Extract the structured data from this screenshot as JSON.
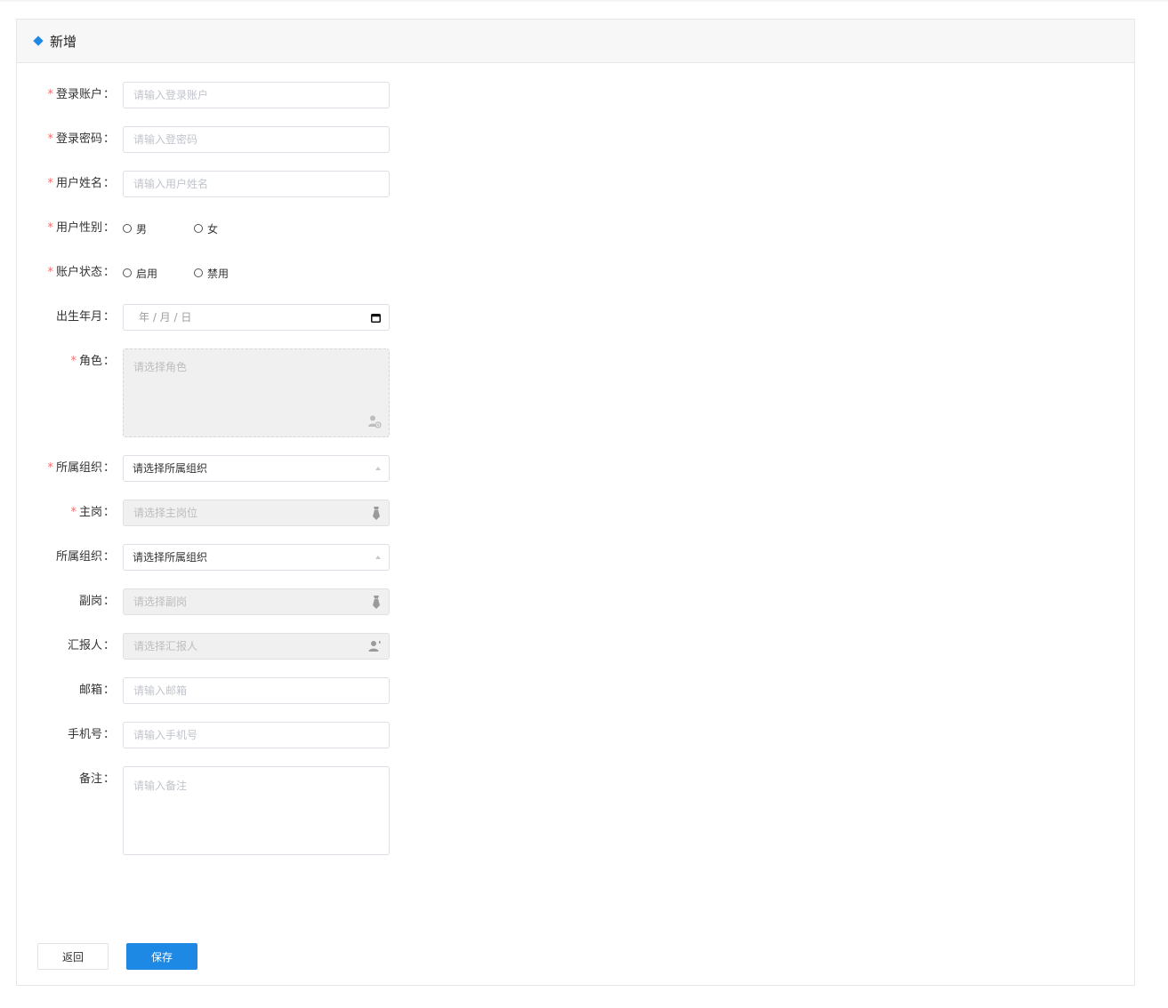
{
  "page": {
    "title": "新增",
    "accent_color": "#1e88e5",
    "required_color": "#f56c6c"
  },
  "form": {
    "login_account": {
      "label": "登录账户",
      "placeholder": "请输入登录账户",
      "required": true
    },
    "login_password": {
      "label": "登录密码",
      "placeholder": "请输入登密码",
      "required": true
    },
    "user_name": {
      "label": "用户姓名",
      "placeholder": "请输入用户姓名",
      "required": true
    },
    "gender": {
      "label": "用户性别",
      "required": true,
      "options": [
        "男",
        "女"
      ]
    },
    "account_status": {
      "label": "账户状态",
      "required": true,
      "options": [
        "启用",
        "禁用"
      ]
    },
    "birth_date": {
      "label": "出生年月",
      "placeholder": "年 / 月 / 日",
      "required": false,
      "icon": "calendar-icon"
    },
    "role": {
      "label": "角色",
      "placeholder": "请选择角色",
      "required": true,
      "icon": "user-add-icon"
    },
    "org_primary": {
      "label": "所属组织",
      "value": "请选择所属组织",
      "required": true,
      "icon": "caret-up-icon"
    },
    "main_post": {
      "label": "主岗",
      "placeholder": "请选择主岗位",
      "required": true,
      "icon": "tie-icon"
    },
    "org_secondary": {
      "label": "所属组织",
      "value": "请选择所属组织",
      "required": false,
      "icon": "caret-up-icon"
    },
    "sub_post": {
      "label": "副岗",
      "placeholder": "请选择副岗",
      "required": false,
      "icon": "tie-icon"
    },
    "reporter": {
      "label": "汇报人",
      "placeholder": "请选择汇报人",
      "required": false,
      "icon": "user-icon"
    },
    "email": {
      "label": "邮箱",
      "placeholder": "请输入邮箱",
      "required": false
    },
    "phone": {
      "label": "手机号",
      "placeholder": "请输入手机号",
      "required": false
    },
    "remark": {
      "label": "备注",
      "placeholder": "请输入备注",
      "required": false
    },
    "colon": "："
  },
  "actions": {
    "back_label": "返回",
    "save_label": "保存"
  }
}
